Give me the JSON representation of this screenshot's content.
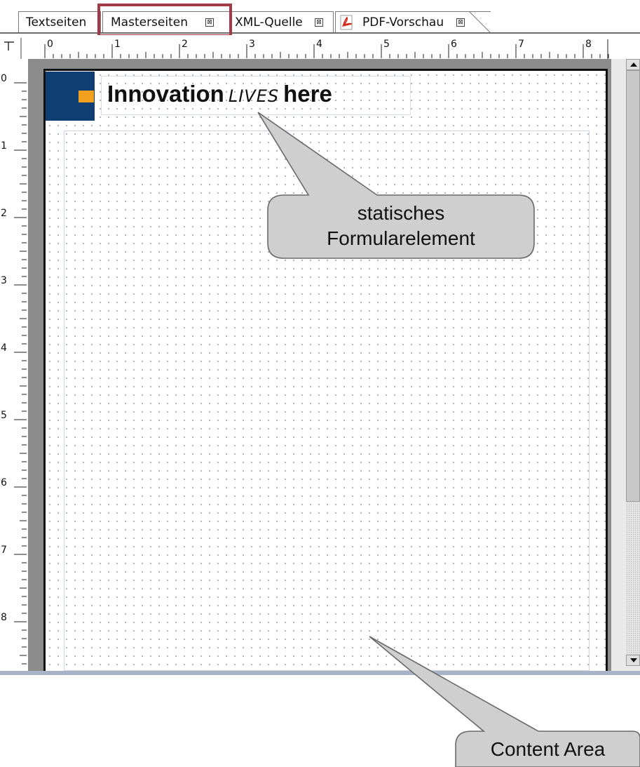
{
  "tabs": [
    {
      "label": "Textseiten"
    },
    {
      "label": "Masterseiten"
    },
    {
      "label": "XML-Quelle"
    },
    {
      "label": "PDF-Vorschau"
    }
  ],
  "tab_close_glyph": "⊠",
  "ruler": {
    "horizontal": [
      "0",
      "1",
      "2",
      "3",
      "4",
      "5",
      "6",
      "7",
      "8"
    ],
    "vertical": [
      "0",
      "1",
      "2",
      "3",
      "4",
      "5",
      "6",
      "7",
      "8"
    ]
  },
  "page": {
    "title_bold_1": "Innovation",
    "title_italic": "LIVES",
    "title_bold_2": "here"
  },
  "callouts": {
    "static_element": [
      "statisches",
      "Formularelement"
    ],
    "content_area": "Content Area"
  },
  "colors": {
    "highlight": "#a43a45",
    "logo_blue": "#0f3f72",
    "logo_orange": "#f2a11e",
    "callout_fill": "#cfcfcf"
  }
}
